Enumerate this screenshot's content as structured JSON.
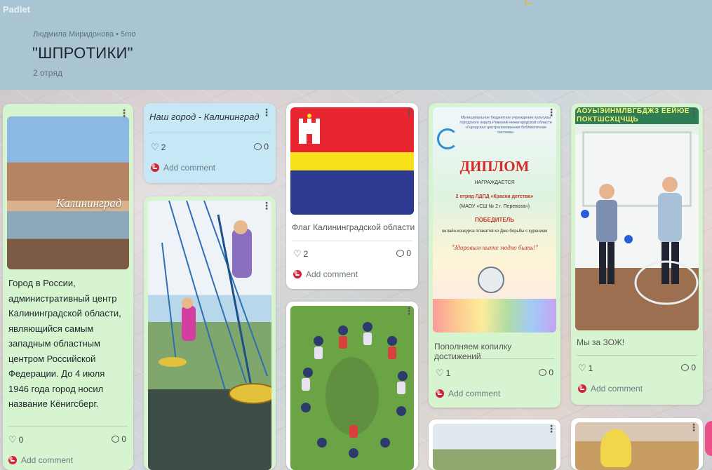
{
  "app": {
    "brand": "Padlet"
  },
  "header": {
    "meta": "Людмила Миридонова • 5mo",
    "title": "\"ШПРОТИКИ\"",
    "subtitle": "2 отряд"
  },
  "ui": {
    "add_comment": "Add comment",
    "menu_glyph": "⋮"
  },
  "cards": {
    "city": {
      "image_text": "Калининград",
      "text": "Город в России, административный центр Калининградской области, являющийся самым западным областным центром Российской Федерации. До 4 июля 1946 года город носил название Кёнигсберг.",
      "likes": "0",
      "comments": "0"
    },
    "our_city": {
      "title": "Наш город - Калининград",
      "likes": "2",
      "comments": "0"
    },
    "swings": {},
    "flag": {
      "caption": "Флаг Калининградской области",
      "likes": "2",
      "comments": "0"
    },
    "kids_circle": {},
    "diploma": {
      "header_text": "Муниципальное бюджетное учреждение культуры городского округа Рижский Нижегородской области «Городская централизованная библиотечная система»",
      "title": "ДИПЛОМ",
      "line1": "НАГРАЖДАЕТСЯ",
      "line2": "2 отряд ЛДПД «Краски детства»",
      "line3": "(МАОУ «СШ № 2 г. Перевоза»)",
      "winner": "ПОБЕДИТЕЛЬ",
      "line4": "онлайн-конкурса плакатов ко Дню борьбы с курением",
      "motto": "\"Здоровым нынче модно быть!\"",
      "caption": "Пополняем копилку достижений",
      "likes": "1",
      "comments": "0"
    },
    "zozh": {
      "board_letters": "АОУЫЭИНМЛВГБДЖЗ ЁЕЙЮЕ ПОКТШСХЦЧЩЬ",
      "caption": "Мы за ЗОЖ!",
      "likes": "1",
      "comments": "0"
    }
  },
  "colors": {
    "header_bg": "#a9c4d3",
    "card_green": "#d7f4d0",
    "card_blue": "#c6e8f6",
    "flag_red": "#e8262f",
    "flag_yellow": "#f8e11a",
    "flag_blue": "#2c3a92",
    "avatar_red": "#d0243a"
  }
}
